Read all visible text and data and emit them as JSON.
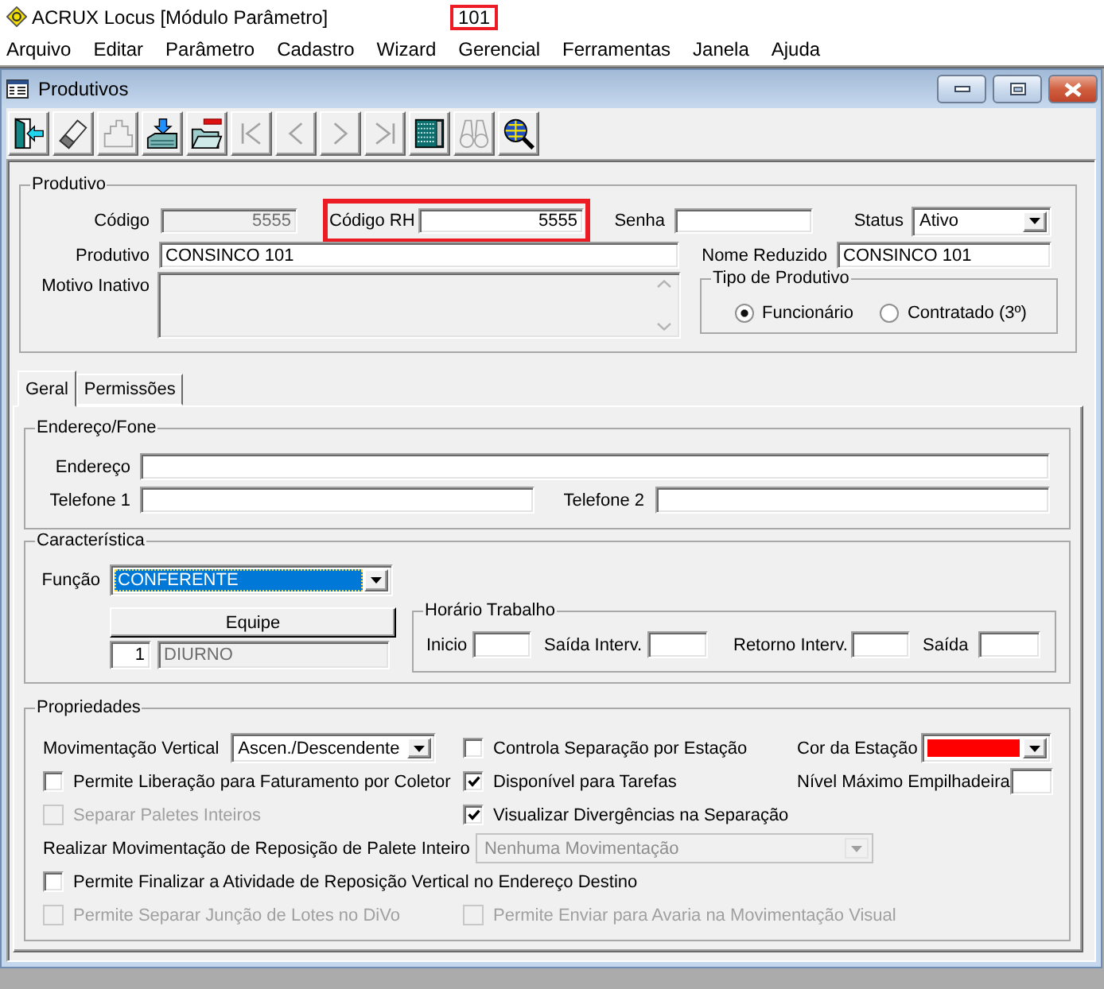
{
  "app": {
    "title": "ACRUX Locus [Módulo Parâmetro]",
    "badge": "101"
  },
  "menu": [
    "Arquivo",
    "Editar",
    "Parâmetro",
    "Cadastro",
    "Wizard",
    "Gerencial",
    "Ferramentas",
    "Janela",
    "Ajuda"
  ],
  "window": {
    "title": "Produtivos"
  },
  "toolbar": [
    {
      "kind": "exit",
      "disabled": false
    },
    {
      "kind": "edit",
      "disabled": false
    },
    {
      "kind": "puzzle",
      "disabled": true
    },
    {
      "kind": "save",
      "disabled": false
    },
    {
      "kind": "delete",
      "disabled": false
    },
    {
      "kind": "first",
      "disabled": true
    },
    {
      "kind": "previous",
      "disabled": true
    },
    {
      "kind": "next",
      "disabled": true
    },
    {
      "kind": "last",
      "disabled": true
    },
    {
      "kind": "grid",
      "disabled": false
    },
    {
      "kind": "binoculars",
      "disabled": true
    },
    {
      "kind": "search",
      "disabled": false
    }
  ],
  "produtivo": {
    "title": "Produtivo",
    "codigo": {
      "label": "Código",
      "value": "5555",
      "disabled": true
    },
    "codigo_rh": {
      "label": "Código RH",
      "value": "5555",
      "highlighted": true
    },
    "senha": {
      "label": "Senha"
    },
    "status": {
      "label": "Status",
      "value": "Ativo"
    },
    "produtivo": {
      "label": "Produtivo",
      "value": "CONSINCO 101"
    },
    "nome_reduzido": {
      "label": "Nome Reduzido",
      "value": "CONSINCO 101"
    },
    "motivo_inativo": {
      "label": "Motivo Inativo",
      "disabled": true
    },
    "tipo_de_produtivo": {
      "title": "Tipo de Produtivo",
      "options": [
        {
          "label": "Funcionário",
          "selected": true
        },
        {
          "label": "Contratado (3º)",
          "selected": false
        }
      ]
    }
  },
  "tabs": [
    {
      "label": "Geral",
      "selected": true
    },
    {
      "label": "Permissões",
      "selected": false
    }
  ],
  "endereco_fone": {
    "title": "Endereço/Fone",
    "endereco": {
      "label": "Endereço"
    },
    "telefone_1": {
      "label": "Telefone 1"
    },
    "telefone_2": {
      "label": "Telefone 2"
    }
  },
  "caracteristica": {
    "title": "Característica",
    "funcao": {
      "label": "Função",
      "value": "CONFERENTE",
      "focused": true
    },
    "equipe": {
      "button": "Equipe",
      "code": "1",
      "name": "DIURNO"
    },
    "horario_trabalho": {
      "title": "Horário Trabalho",
      "fields": [
        {
          "label": "Inicio"
        },
        {
          "label": "Saída Interv."
        },
        {
          "label": "Retorno Interv."
        },
        {
          "label": "Saída"
        }
      ]
    }
  },
  "propriedades": {
    "title": "Propriedades",
    "movimentacao_vertical": {
      "label": "Movimentação Vertical",
      "value": "Ascen./Descendente"
    },
    "cor_da_estacao": {
      "label": "Cor da Estação",
      "color": "#ff0000"
    },
    "nivel_maximo_empilhadeira": {
      "label": "Nível Máximo Empilhadeira"
    },
    "options": [
      {
        "label": "Controla Separação por Estação",
        "checked": false,
        "disabled": false
      },
      {
        "label": "Permite Liberação para Faturamento por Coletor",
        "checked": false,
        "disabled": false
      },
      {
        "label": "Disponível para Tarefas",
        "checked": true,
        "disabled": false
      },
      {
        "label": "Separar Paletes Inteiros",
        "checked": false,
        "disabled": true
      },
      {
        "label": "Visualizar Divergências na Separação",
        "checked": true,
        "disabled": false
      }
    ],
    "reposicao_palete_inteiro": {
      "label": "Realizar Movimentação de Reposição de Palete Inteiro",
      "value": "Nenhuma Movimentação",
      "disabled": true
    },
    "more_options": [
      {
        "label": "Permite Finalizar a Atividade de Reposição Vertical no Endereço Destino",
        "checked": false,
        "disabled": false
      },
      {
        "label": "Permite Separar Junção de Lotes no DiVo",
        "checked": false,
        "disabled": true
      },
      {
        "label": "Permite Enviar para Avaria na Movimentação Visual",
        "checked": false,
        "disabled": true
      }
    ]
  }
}
